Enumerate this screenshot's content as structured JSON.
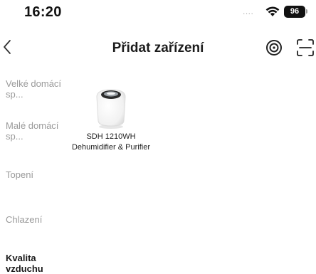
{
  "status_bar": {
    "time": "16:20",
    "signal": "....",
    "battery": "96"
  },
  "header": {
    "title": "Přidat zařízení"
  },
  "categories": [
    {
      "label": "Velké domácí sp...",
      "active": false
    },
    {
      "label": "Malé domácí sp...",
      "active": false
    },
    {
      "label": "Topení",
      "active": false
    },
    {
      "label": "Chlazení",
      "active": false
    },
    {
      "label": "Kvalita vzduchu",
      "active": true
    }
  ],
  "devices": [
    {
      "name": "SDH 1210WH Dehumidifier & Purifier"
    }
  ],
  "colors": {
    "active_text": "#1a1a1a",
    "inactive_text": "#9a9a9a",
    "background": "#ffffff"
  }
}
